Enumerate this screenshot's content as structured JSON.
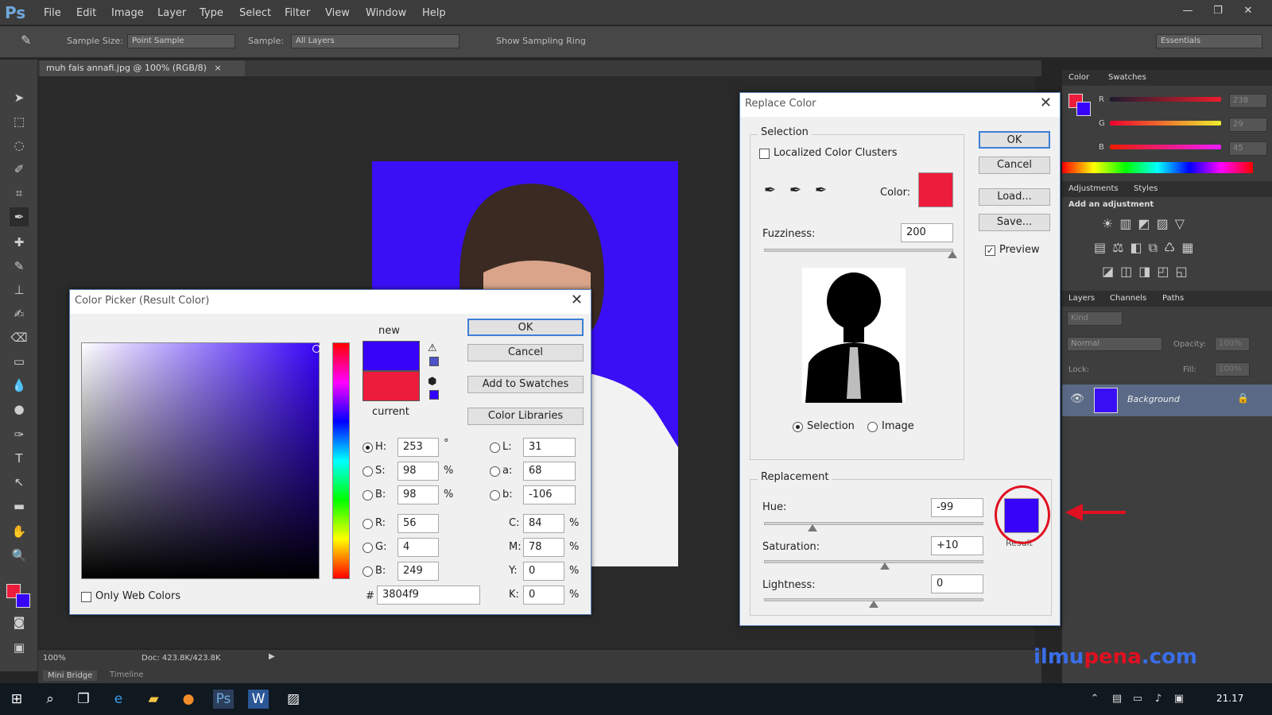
{
  "app": {
    "logo": "Ps"
  },
  "menu": [
    "File",
    "Edit",
    "Image",
    "Layer",
    "Type",
    "Select",
    "Filter",
    "View",
    "Window",
    "Help"
  ],
  "window_controls": {
    "minimize": "—",
    "restore": "❐",
    "close": "✕"
  },
  "options_bar": {
    "sample_size_label": "Sample Size:",
    "sample_size_value": "Point Sample",
    "sample_label": "Sample:",
    "sample_value": "All Layers",
    "sampling_ring_label": "Show Sampling Ring",
    "workspace": "Essentials"
  },
  "document_tab": {
    "title": "muh fais annafi.jpg @ 100% (RGB/8)",
    "close": "×"
  },
  "status_bar": {
    "zoom": "100%",
    "doc": "Doc: 423.8K/423.8K"
  },
  "bottom_tabs": [
    "Mini Bridge",
    "Timeline"
  ],
  "color_picker": {
    "title": "Color Picker (Result Color)",
    "new_label": "new",
    "current_label": "current",
    "new_color": "#3804f9",
    "current_color": "#ed1c3c",
    "buttons": {
      "ok": "OK",
      "cancel": "Cancel",
      "add_swatches": "Add to Swatches",
      "libraries": "Color Libraries"
    },
    "hsb": [
      {
        "label": "H:",
        "value": "253",
        "unit": "°"
      },
      {
        "label": "S:",
        "value": "98",
        "unit": "%"
      },
      {
        "label": "B:",
        "value": "98",
        "unit": "%"
      }
    ],
    "rgb": [
      {
        "label": "R:",
        "value": "56"
      },
      {
        "label": "G:",
        "value": "4"
      },
      {
        "label": "B:",
        "value": "249"
      }
    ],
    "lab": [
      {
        "label": "L:",
        "value": "31"
      },
      {
        "label": "a:",
        "value": "68"
      },
      {
        "label": "b:",
        "value": "-106"
      }
    ],
    "cmyk": [
      {
        "label": "C:",
        "value": "84",
        "unit": "%"
      },
      {
        "label": "M:",
        "value": "78",
        "unit": "%"
      },
      {
        "label": "Y:",
        "value": "0",
        "unit": "%"
      },
      {
        "label": "K:",
        "value": "0",
        "unit": "%"
      }
    ],
    "hex_label": "#",
    "hex": "3804f9",
    "only_web_colors": "Only Web Colors"
  },
  "replace_color": {
    "title": "Replace Color",
    "selection_group": "Selection",
    "localized_label": "Localized Color Clusters",
    "color_label": "Color:",
    "sel_color": "#ed1c3c",
    "fuzziness_label": "Fuzziness:",
    "fuzziness_value": "200",
    "fuzziness_level": 1.0,
    "view_selection": "Selection",
    "view_image": "Image",
    "replacement_group": "Replacement",
    "hue_label": "Hue:",
    "hue_value": "-99",
    "hue_level": 0.22,
    "saturation_label": "Saturation:",
    "saturation_value": "+10",
    "saturation_level": 0.55,
    "lightness_label": "Lightness:",
    "lightness_value": "0",
    "lightness_level": 0.5,
    "result_color": "#3804f9",
    "result_label": "Result",
    "buttons": {
      "ok": "OK",
      "cancel": "Cancel",
      "load": "Load...",
      "save": "Save..."
    },
    "preview_label": "Preview"
  },
  "panels": {
    "color_tabs": [
      "Color",
      "Swatches"
    ],
    "color_values": [
      {
        "label": "R",
        "value": "238"
      },
      {
        "label": "G",
        "value": "29"
      },
      {
        "label": "B",
        "value": "45"
      }
    ],
    "adjust_tabs": [
      "Adjustments",
      "Styles"
    ],
    "add_adjustment": "Add an adjustment",
    "layers_tabs": [
      "Layers",
      "Channels",
      "Paths"
    ],
    "kind": "Kind",
    "blend_mode": "Normal",
    "opacity_label": "Opacity:",
    "opacity_value": "100%",
    "lock_label": "Lock:",
    "fill_label": "Fill:",
    "fill_value": "100%",
    "layer_name": "Background"
  },
  "taskbar": {
    "time": "21.17"
  },
  "watermark": {
    "part1": "ilmu",
    "part2": "pena",
    "part3": ".com"
  },
  "colors": {
    "foreground": "#ed1c3c",
    "background_swatch": "#3804f9",
    "photo_bg": "#3a0ff6",
    "highlight": "#e01020"
  }
}
